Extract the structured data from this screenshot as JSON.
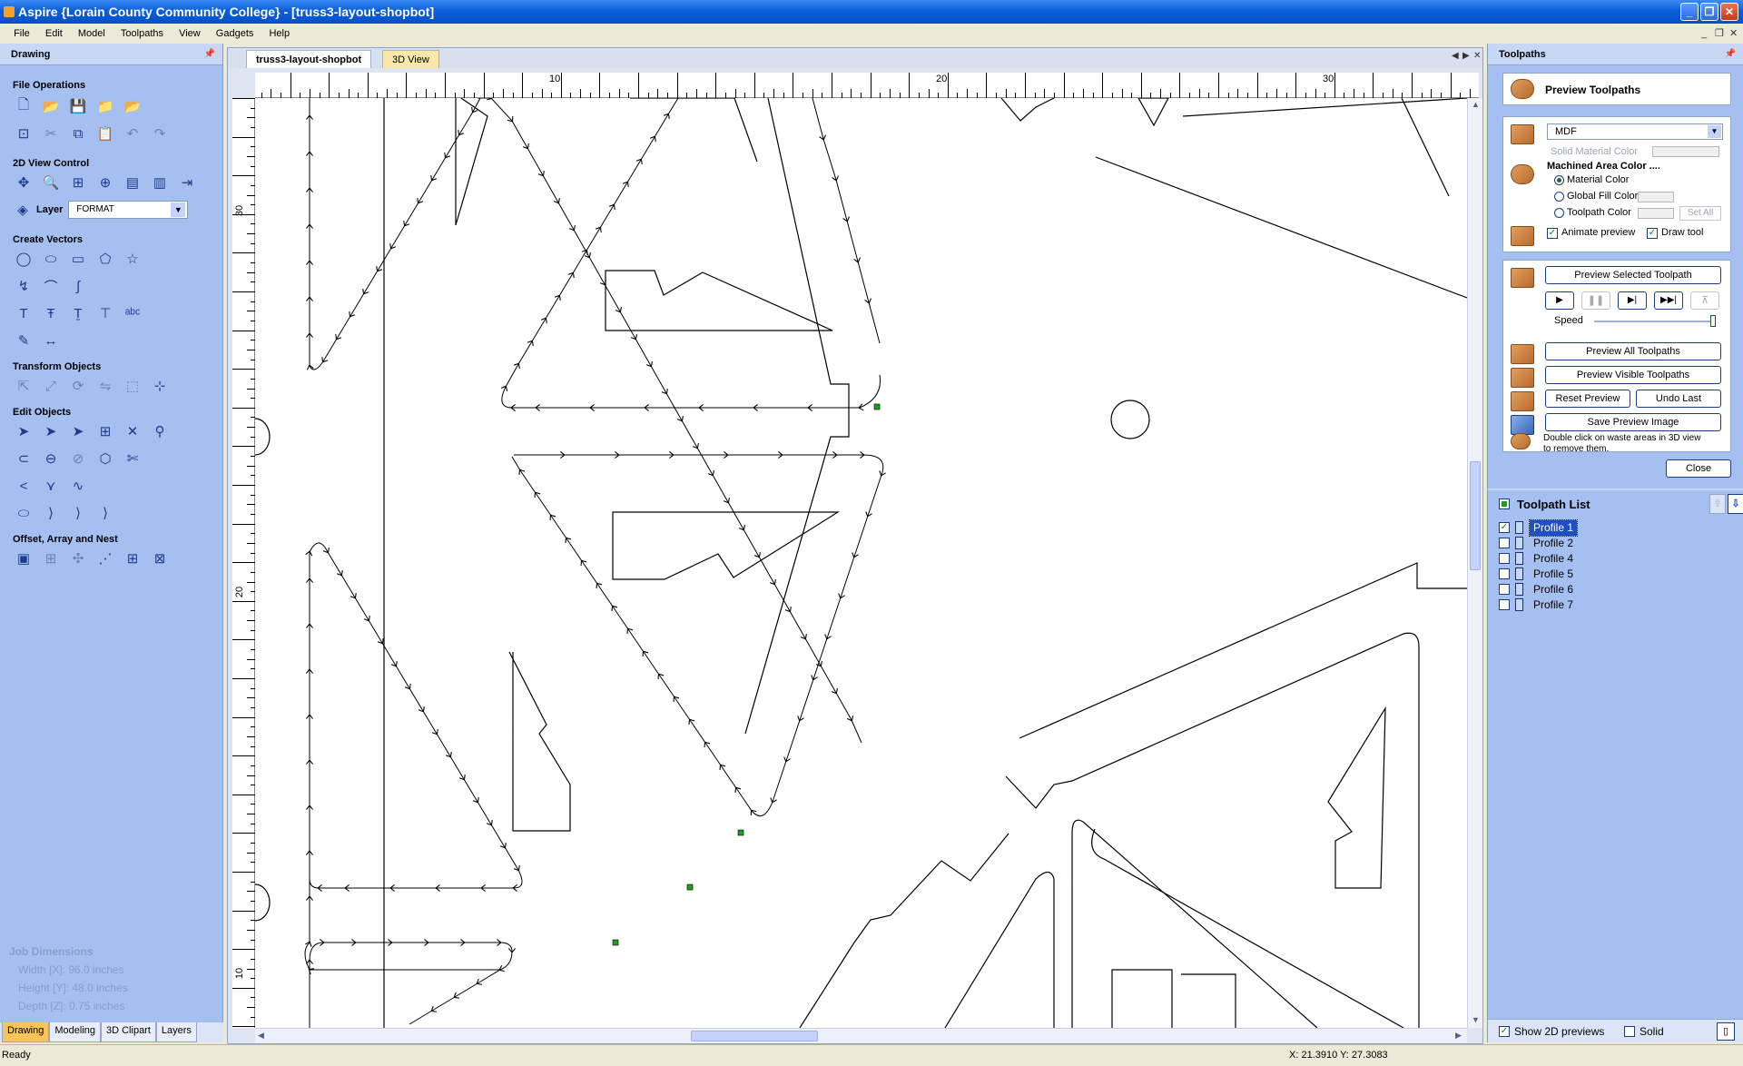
{
  "window": {
    "title": "Aspire {Lorain County Community College} - [truss3-layout-shopbot]",
    "minimize": "_",
    "restore": "❐",
    "close": "✕"
  },
  "menu": [
    "File",
    "Edit",
    "Model",
    "Toolpaths",
    "View",
    "Gadgets",
    "Help"
  ],
  "mdi": {
    "min": "_",
    "restore": "❐",
    "close": "✕"
  },
  "left_panel": {
    "title": "Drawing",
    "sections": {
      "file_ops": "File Operations",
      "view_2d": "2D View Control",
      "create_vectors": "Create Vectors",
      "transform": "Transform Objects",
      "edit_objects": "Edit Objects",
      "offset_array": "Offset, Array and Nest"
    },
    "layer_label": "Layer",
    "layer_value": "FORMAT",
    "job_dimensions": {
      "title": "Job Dimensions",
      "width": "Width  [X]: 96.0 inches",
      "height": "Height [Y]: 48.0 inches",
      "depth": "Depth  [Z]: 0.75 inches"
    },
    "tabs": [
      "Drawing",
      "Modeling",
      "3D Clipart",
      "Layers"
    ]
  },
  "document": {
    "tab_active": "truss3-layout-shopbot",
    "tab_3d": "3D View",
    "hruler": [
      "10",
      "20",
      "30"
    ],
    "vruler": [
      "30",
      "20",
      "10"
    ]
  },
  "right_panel": {
    "title": "Toolpaths",
    "preview_title": "Preview Toolpaths",
    "material": "MDF",
    "solid_material_color": "Solid Material Color",
    "machined_area_color": "Machined Area Color ....",
    "material_color": "Material Color",
    "global_fill_color": "Global Fill Color",
    "toolpath_color": "Toolpath Color",
    "set_all": "Set All",
    "animate_preview": "Animate preview",
    "draw_tool": "Draw tool",
    "preview_selected": "Preview Selected Toolpath",
    "speed": "Speed",
    "preview_all": "Preview All Toolpaths",
    "preview_visible": "Preview Visible Toolpaths",
    "reset_preview": "Reset Preview",
    "undo_last": "Undo Last",
    "save_preview_image": "Save Preview Image",
    "hint_line1": "Double click on waste areas in 3D view",
    "hint_line2": "to remove them.",
    "close": "Close",
    "toolpath_list_title": "Toolpath List",
    "toolpaths": [
      "Profile 1",
      "Profile 2",
      "Profile 4",
      "Profile 5",
      "Profile 6",
      "Profile 7"
    ],
    "show_2d_previews": "Show 2D previews",
    "solid": "Solid"
  },
  "status": {
    "ready": "Ready",
    "coords": "X: 21.3910 Y: 27.3083"
  },
  "colors": {
    "title_bar": "#0a5fd8",
    "panel_bg": "#a4bff0",
    "active_left_tab": "#f7c55b",
    "selection": "#1f4fc4",
    "toolpath_start_marker": "#1aa01a"
  }
}
